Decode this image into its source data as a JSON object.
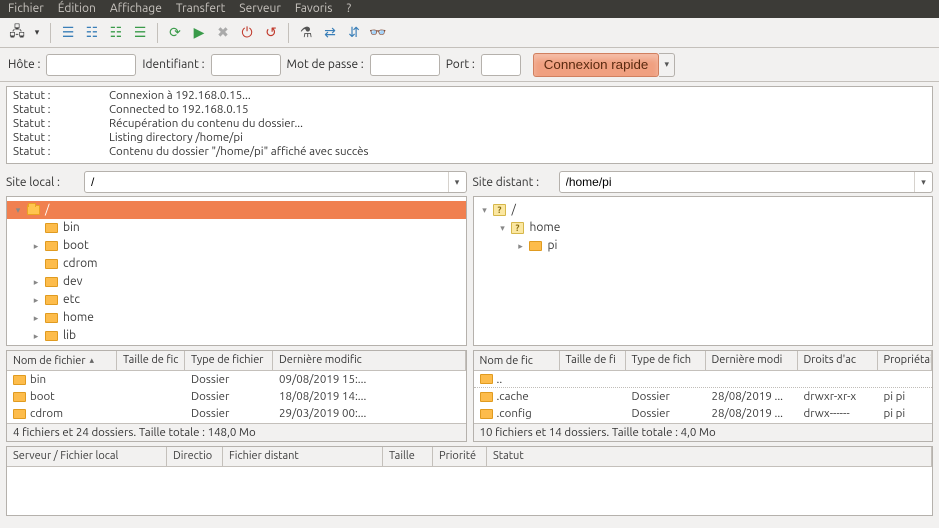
{
  "menu": [
    "Fichier",
    "Édition",
    "Affichage",
    "Transfert",
    "Serveur",
    "Favoris",
    "?"
  ],
  "toolbar_icons": [
    {
      "name": "site-manager-icon",
      "glyph": "🖧"
    },
    {
      "name": "toggle-dropdown-icon",
      "glyph": "▾"
    },
    {
      "name": "toggle-log-icon",
      "glyph": "☰"
    },
    {
      "name": "toggle-local-tree-icon",
      "glyph": "☷"
    },
    {
      "name": "toggle-remote-tree-icon",
      "glyph": "☷"
    },
    {
      "name": "toggle-queue-icon",
      "glyph": "☰"
    },
    {
      "name": "refresh-icon",
      "glyph": "⟳"
    },
    {
      "name": "process-queue-icon",
      "glyph": "▶"
    },
    {
      "name": "cancel-icon",
      "glyph": "✖"
    },
    {
      "name": "disconnect-icon",
      "glyph": "⏻"
    },
    {
      "name": "reconnect-icon",
      "glyph": "↺"
    },
    {
      "name": "filter-icon",
      "glyph": "⚗"
    },
    {
      "name": "compare-icon",
      "glyph": "⇄"
    },
    {
      "name": "sync-browse-icon",
      "glyph": "⇵"
    },
    {
      "name": "search-icon",
      "glyph": "👓"
    }
  ],
  "quickconnect": {
    "host_label": "Hôte :",
    "host": "",
    "user_label": "Identifiant :",
    "user": "",
    "pass_label": "Mot de passe :",
    "pass": "",
    "port_label": "Port :",
    "port": "",
    "button": "Connexion rapide"
  },
  "log": [
    {
      "k": "Statut :",
      "v": "Connexion à 192.168.0.15..."
    },
    {
      "k": "Statut :",
      "v": "Connected to 192.168.0.15"
    },
    {
      "k": "Statut :",
      "v": "Récupération du contenu du dossier..."
    },
    {
      "k": "Statut :",
      "v": "Listing directory /home/pi"
    },
    {
      "k": "Statut :",
      "v": "Contenu du dossier \"/home/pi\" affiché avec succès"
    }
  ],
  "local": {
    "label": "Site local :",
    "path": "/",
    "tree": [
      {
        "indent": 1,
        "tw": "▾",
        "icon": "folder-open",
        "label": "/",
        "sel": true
      },
      {
        "indent": 2,
        "tw": "",
        "icon": "folder",
        "label": "bin"
      },
      {
        "indent": 2,
        "tw": "▸",
        "icon": "folder",
        "label": "boot"
      },
      {
        "indent": 2,
        "tw": "",
        "icon": "folder",
        "label": "cdrom"
      },
      {
        "indent": 2,
        "tw": "▸",
        "icon": "folder",
        "label": "dev"
      },
      {
        "indent": 2,
        "tw": "▸",
        "icon": "folder",
        "label": "etc"
      },
      {
        "indent": 2,
        "tw": "▸",
        "icon": "folder",
        "label": "home"
      },
      {
        "indent": 2,
        "tw": "▸",
        "icon": "folder",
        "label": "lib"
      }
    ],
    "cols": {
      "name": "Nom de fichier",
      "size": "Taille de fic",
      "type": "Type de fichier",
      "mod": "Dernière modific"
    },
    "rows": [
      {
        "n": "bin",
        "t": "Dossier",
        "m": "09/08/2019 15:..."
      },
      {
        "n": "boot",
        "t": "Dossier",
        "m": "18/08/2019 14:..."
      },
      {
        "n": "cdrom",
        "t": "Dossier",
        "m": "29/03/2019 00:..."
      }
    ],
    "status": "4 fichiers et 24 dossiers. Taille totale : 148,0 Mo"
  },
  "remote": {
    "label": "Site distant :",
    "path": "/home/pi",
    "tree": [
      {
        "indent": 1,
        "tw": "▾",
        "icon": "question",
        "label": "/"
      },
      {
        "indent": 2,
        "tw": "▾",
        "icon": "question",
        "label": "home"
      },
      {
        "indent": 3,
        "tw": "▸",
        "icon": "folder",
        "label": "pi"
      }
    ],
    "cols": {
      "name": "Nom de fic",
      "size": "Taille de fi",
      "type": "Type de fich",
      "mod": "Dernière modi",
      "perm": "Droits d'ac",
      "own": "Propriétair"
    },
    "rows": [
      {
        "n": "..",
        "parent": true
      },
      {
        "n": ".cache",
        "t": "Dossier",
        "m": "28/08/2019 ...",
        "p": "drwxr-xr-x",
        "o": "pi pi"
      },
      {
        "n": ".config",
        "t": "Dossier",
        "m": "28/08/2019 ...",
        "p": "drwx------",
        "o": "pi pi"
      }
    ],
    "status": "10 fichiers et 14 dossiers. Taille totale : 4,0 Mo"
  },
  "queue": {
    "cols": [
      "Serveur / Fichier local",
      "Directio",
      "Fichier distant",
      "Taille",
      "Priorité",
      "Statut"
    ]
  }
}
